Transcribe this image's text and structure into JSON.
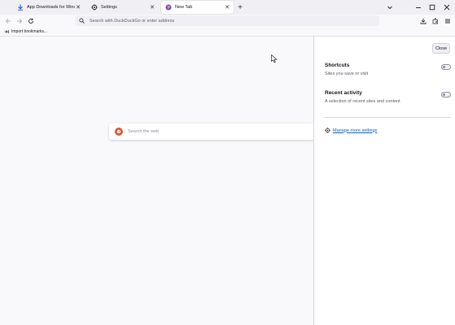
{
  "tabs": [
    {
      "title": "App Downloads for Windows",
      "icon": "download-arrow-icon",
      "active": false
    },
    {
      "title": "Settings",
      "icon": "gear-icon",
      "active": false
    },
    {
      "title": "New Tab",
      "icon": "firefox-icon",
      "active": true
    }
  ],
  "urlbar": {
    "placeholder": "Search with DuckDuckGo or enter address"
  },
  "bookmarks": {
    "import_label": "Import bookmarks..."
  },
  "search": {
    "placeholder": "Search the web"
  },
  "panel": {
    "close_label": "Close",
    "shortcuts": {
      "title": "Shortcuts",
      "description": "Sites you save or visit",
      "enabled": false
    },
    "recent_activity": {
      "title": "Recent activity",
      "description": "A selection of recent sites and content",
      "enabled": false
    },
    "manage_label": "Manage more settings"
  },
  "colors": {
    "accent": "#0061e0",
    "ddg": "#de5833",
    "tabstrip": "#f0f0f4"
  }
}
